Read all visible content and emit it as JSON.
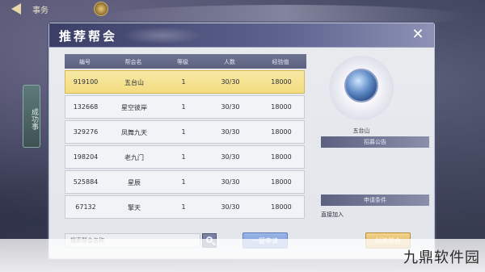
{
  "top_bar": {
    "title": "事务"
  },
  "background": {
    "left_scroll_text": "成功事"
  },
  "dialog": {
    "title": "推荐帮会",
    "close_icon": "close-icon"
  },
  "table": {
    "headers": [
      "编号",
      "帮会名",
      "等级",
      "人数",
      "经验值"
    ],
    "rows": [
      {
        "id": "919100",
        "name": "五台山",
        "level": "1",
        "members": "30/30",
        "exp": "18000",
        "selected": true
      },
      {
        "id": "132668",
        "name": "星空彼岸",
        "level": "1",
        "members": "30/30",
        "exp": "18000",
        "selected": false
      },
      {
        "id": "329276",
        "name": "凤舞九天",
        "level": "1",
        "members": "30/30",
        "exp": "18000",
        "selected": false
      },
      {
        "id": "198204",
        "name": "老九门",
        "level": "1",
        "members": "30/30",
        "exp": "18000",
        "selected": false
      },
      {
        "id": "525884",
        "name": "星辰",
        "level": "1",
        "members": "30/30",
        "exp": "18000",
        "selected": false
      },
      {
        "id": "67132",
        "name": "擎天",
        "level": "1",
        "members": "30/30",
        "exp": "18000",
        "selected": false
      }
    ]
  },
  "side": {
    "emblem_icon": "guild-emblem-icon",
    "guild_name": "五台山",
    "announcement_label": "招募公告",
    "conditions_label": "申请条件",
    "conditions_text": "直接加入"
  },
  "bottom": {
    "search_placeholder": "搜索帮会名称",
    "search_icon": "search-icon",
    "join_label": "一键申请",
    "create_label": "创建帮会"
  },
  "watermark": "九鼎软件园"
}
